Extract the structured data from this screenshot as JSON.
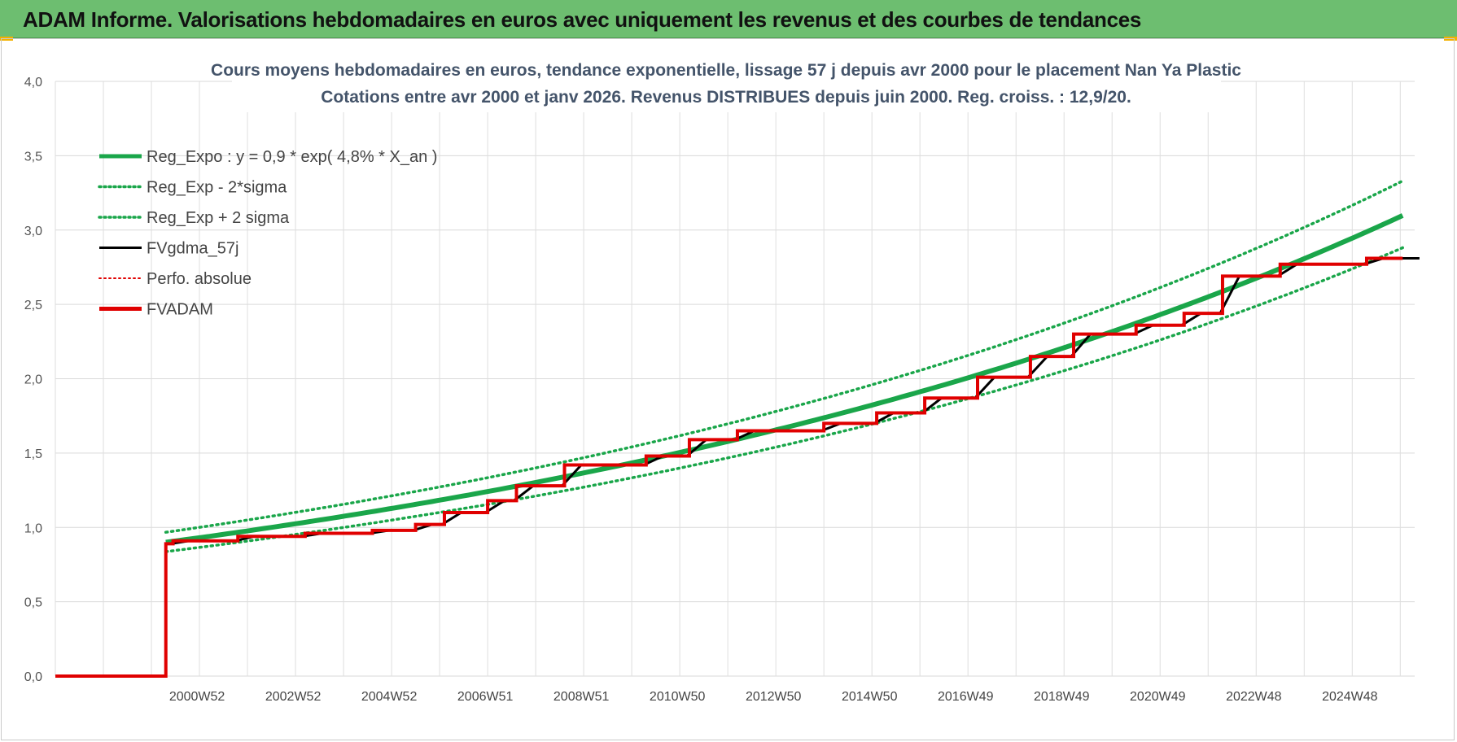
{
  "banner": {
    "title": "ADAM Informe. Valorisations hebdomadaires en euros avec uniquement les revenus et des courbes de tendances"
  },
  "colors": {
    "banner_bg": "#6dbe70",
    "accent_yellow": "#f2b100",
    "reg_expo": "#1aa64a",
    "fvgdma": "#000000",
    "fvadam": "#e00000",
    "title_text": "#44546a"
  },
  "chart_data": {
    "type": "line",
    "title_lines": [
      "Cours moyens hebdomadaires en euros, tendance exponentielle, lissage 57 j depuis avr 2000 pour le placement Nan Ya Plastic",
      "Cotations entre avr 2000 et janv 2026. Revenus DISTRIBUES depuis juin 2000. Reg. croiss. : 12,9/20."
    ],
    "ylim": [
      0,
      4
    ],
    "y_ticks": [
      "0,0",
      "0,5",
      "1,0",
      "1,5",
      "2,0",
      "2,5",
      "3,0",
      "3,5",
      "4,0"
    ],
    "x_ticks": [
      "2000W52",
      "2002W52",
      "2004W52",
      "2006W51",
      "2008W51",
      "2010W50",
      "2012W50",
      "2014W50",
      "2016W49",
      "2018W49",
      "2020W49",
      "2022W48",
      "2024W48"
    ],
    "grid": true,
    "legend_position": "top-left",
    "legend": [
      {
        "label": "Reg_Expo : y = 0,9 * exp( 4,8% *  X_an )",
        "style": "solid-thick",
        "color": "#1aa64a"
      },
      {
        "label": "Reg_Exp - 2*sigma",
        "style": "dotted",
        "color": "#1aa64a"
      },
      {
        "label": "Reg_Exp + 2 sigma",
        "style": "dotted",
        "color": "#1aa64a"
      },
      {
        "label": "FVgdma_57j",
        "style": "solid",
        "color": "#000000"
      },
      {
        "label": "Perfo. absolue",
        "style": "dotted",
        "color": "#e00000"
      },
      {
        "label": "FVADAM",
        "style": "solid-thick",
        "color": "#e00000"
      }
    ],
    "reg_expo": {
      "a": 0.9,
      "rate": 0.048,
      "start_year": 2000.3,
      "end_year": 2026.05
    },
    "band_factor_minus": 0.93,
    "band_factor_plus": 1.075,
    "fvadam_steps": [
      {
        "x": 1998.0,
        "y": 0.0
      },
      {
        "x": 2000.3,
        "y": 0.89
      },
      {
        "x": 2000.45,
        "y": 0.91
      },
      {
        "x": 2001.8,
        "y": 0.94
      },
      {
        "x": 2003.2,
        "y": 0.96
      },
      {
        "x": 2004.6,
        "y": 0.98
      },
      {
        "x": 2005.5,
        "y": 1.02
      },
      {
        "x": 2006.1,
        "y": 1.1
      },
      {
        "x": 2007.0,
        "y": 1.18
      },
      {
        "x": 2007.6,
        "y": 1.28
      },
      {
        "x": 2008.6,
        "y": 1.42
      },
      {
        "x": 2010.3,
        "y": 1.48
      },
      {
        "x": 2011.2,
        "y": 1.59
      },
      {
        "x": 2012.2,
        "y": 1.65
      },
      {
        "x": 2014.0,
        "y": 1.7
      },
      {
        "x": 2015.1,
        "y": 1.77
      },
      {
        "x": 2016.1,
        "y": 1.87
      },
      {
        "x": 2017.2,
        "y": 2.01
      },
      {
        "x": 2018.3,
        "y": 2.15
      },
      {
        "x": 2019.2,
        "y": 2.3
      },
      {
        "x": 2020.5,
        "y": 2.36
      },
      {
        "x": 2021.5,
        "y": 2.44
      },
      {
        "x": 2022.3,
        "y": 2.69
      },
      {
        "x": 2023.5,
        "y": 2.77
      },
      {
        "x": 2025.3,
        "y": 2.81
      },
      {
        "x": 2026.05,
        "y": 2.81
      }
    ]
  }
}
